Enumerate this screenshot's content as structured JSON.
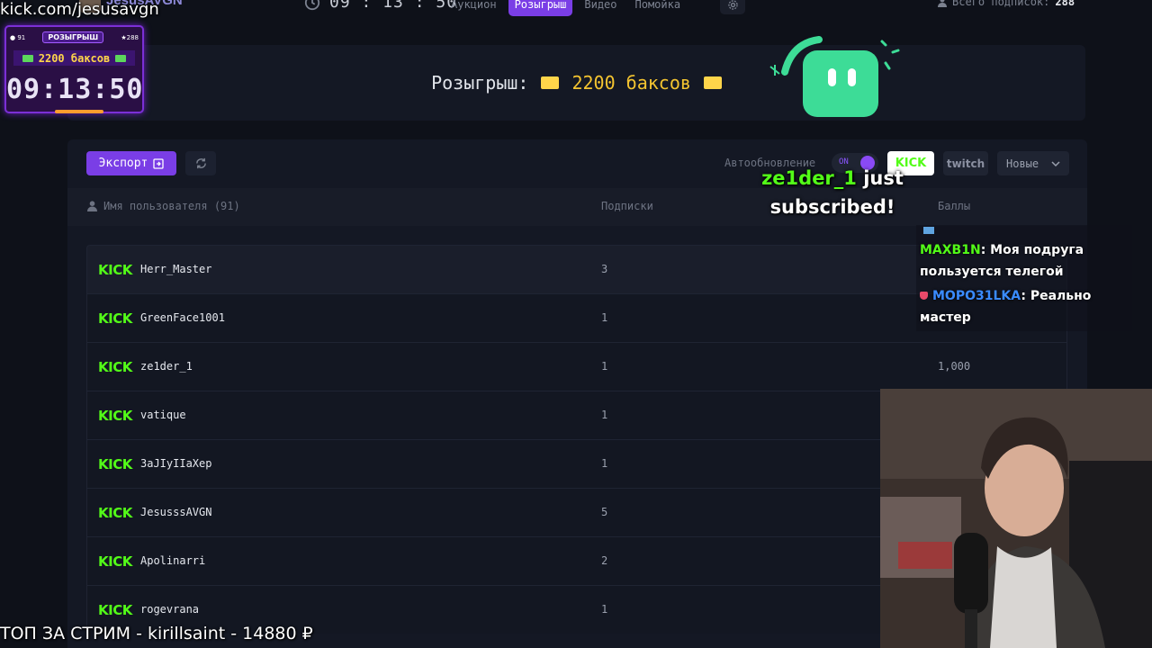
{
  "overlay": {
    "kick_url": "kick.com/jesusavgn",
    "timer_widget": {
      "participants": "91",
      "badge": "РОЗЫГРЫШ",
      "subs": "288",
      "prize": "2200 баксов",
      "time": "09:13:50"
    },
    "alert": {
      "user": "ze1der_1",
      "text": "just subscribed!"
    },
    "ticker": "ТОП ЗА СТРИМ - kirillsaint - 14880 ₽"
  },
  "topbar": {
    "brand": "JesusAVGN",
    "clock": "09 : 13 : 50",
    "tabs": [
      {
        "label": "Аукцион",
        "active": false
      },
      {
        "label": "Розыгрыш",
        "active": true
      },
      {
        "label": "Видео",
        "active": false
      },
      {
        "label": "Помойка",
        "active": false
      }
    ],
    "subs_label": "Всего подписок:",
    "subs_value": "288"
  },
  "banner": {
    "label": "Розыгрыш:",
    "prize": "2200 баксов"
  },
  "toolbar": {
    "export_label": "Экспорт",
    "auto_label": "Автообновление",
    "toggle_state": "ON",
    "platform_kick": "KICK",
    "platform_twitch": "twitch",
    "sort_value": "Новые"
  },
  "table": {
    "col_user": "Имя пользователя (91)",
    "col_subs": "Подписки",
    "col_points": "Баллы",
    "rows": [
      {
        "platform": "KICK",
        "name": "Herr_Master",
        "subs": "3",
        "points": ""
      },
      {
        "platform": "KICK",
        "name": "GreenFace1001",
        "subs": "1",
        "points": ""
      },
      {
        "platform": "KICK",
        "name": "ze1der_1",
        "subs": "1",
        "points": "1,000"
      },
      {
        "platform": "KICK",
        "name": "vatique",
        "subs": "1",
        "points": ""
      },
      {
        "platform": "KICK",
        "name": "3aJIyIIaXep",
        "subs": "1",
        "points": ""
      },
      {
        "platform": "KICK",
        "name": "JesusssAVGN",
        "subs": "5",
        "points": ""
      },
      {
        "platform": "KICK",
        "name": "Apolinarri",
        "subs": "2",
        "points": ""
      },
      {
        "platform": "KICK",
        "name": "rogevrana",
        "subs": "1",
        "points": ""
      }
    ]
  },
  "chat": {
    "messages": [
      {
        "user": "MAXB1N",
        "text": ": Моя подруга пользуется телегой"
      },
      {
        "user": "MOPO31LKA",
        "text": ": Реально мастер"
      }
    ]
  },
  "colors": {
    "accent": "#7a3ee6",
    "kick_green": "#53fc18",
    "background": "#0e1119",
    "panel": "#141824",
    "prize_yellow": "#f4c430"
  }
}
